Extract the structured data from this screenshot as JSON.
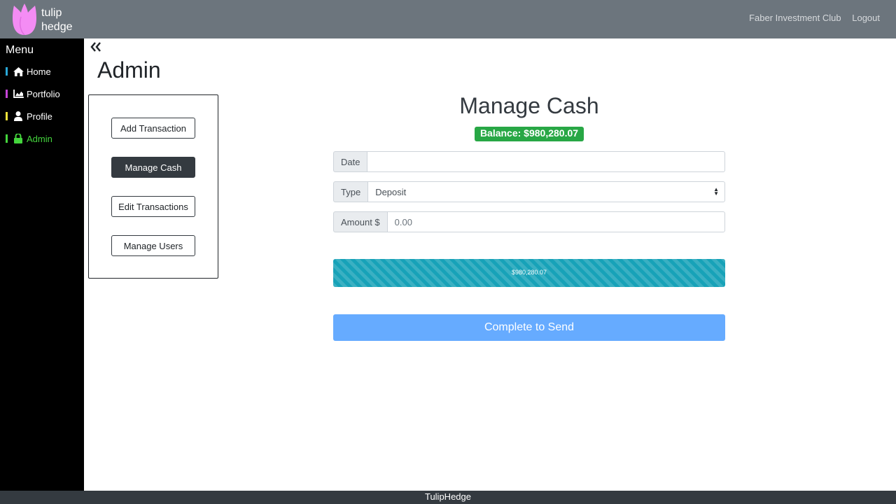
{
  "brand": {
    "line1": "tulip",
    "line2": "hedge",
    "logo_color": "#f48cf4"
  },
  "topbar": {
    "club": "Faber Investment Club",
    "logout": "Logout"
  },
  "sidebar": {
    "title": "Menu",
    "items": [
      {
        "label": "Home",
        "icon": "home-icon",
        "bar_color": "#29a8d8"
      },
      {
        "label": "Portfolio",
        "icon": "chart-area-icon",
        "bar_color": "#c544d8"
      },
      {
        "label": "Profile",
        "icon": "user-icon",
        "bar_color": "#f2e33a"
      },
      {
        "label": "Admin",
        "icon": "lock-icon",
        "bar_color": "#44d53d",
        "active": true
      }
    ]
  },
  "page": {
    "title": "Admin",
    "collapse_icon": "double-chevron-left-icon"
  },
  "admin_menu": {
    "buttons": [
      {
        "label": "Add Transaction"
      },
      {
        "label": "Manage Cash",
        "active": true
      },
      {
        "label": "Edit Transactions"
      },
      {
        "label": "Manage Users"
      }
    ]
  },
  "form": {
    "title": "Manage Cash",
    "balance": "Balance: $980,280.07",
    "date": {
      "label": "Date",
      "value": ""
    },
    "type": {
      "label": "Type",
      "value": "Deposit"
    },
    "amount": {
      "label": "Amount $",
      "placeholder": "0.00"
    },
    "progress": {
      "text": "$980,280.07",
      "percent": 100
    },
    "submit": "Complete to Send"
  },
  "footer": {
    "text": "TulipHedge"
  },
  "colors": {
    "active_green": "#44d53d",
    "badge_green": "#28a745",
    "progress_teal": "#17a2b8",
    "submit_blue": "#66abff"
  }
}
